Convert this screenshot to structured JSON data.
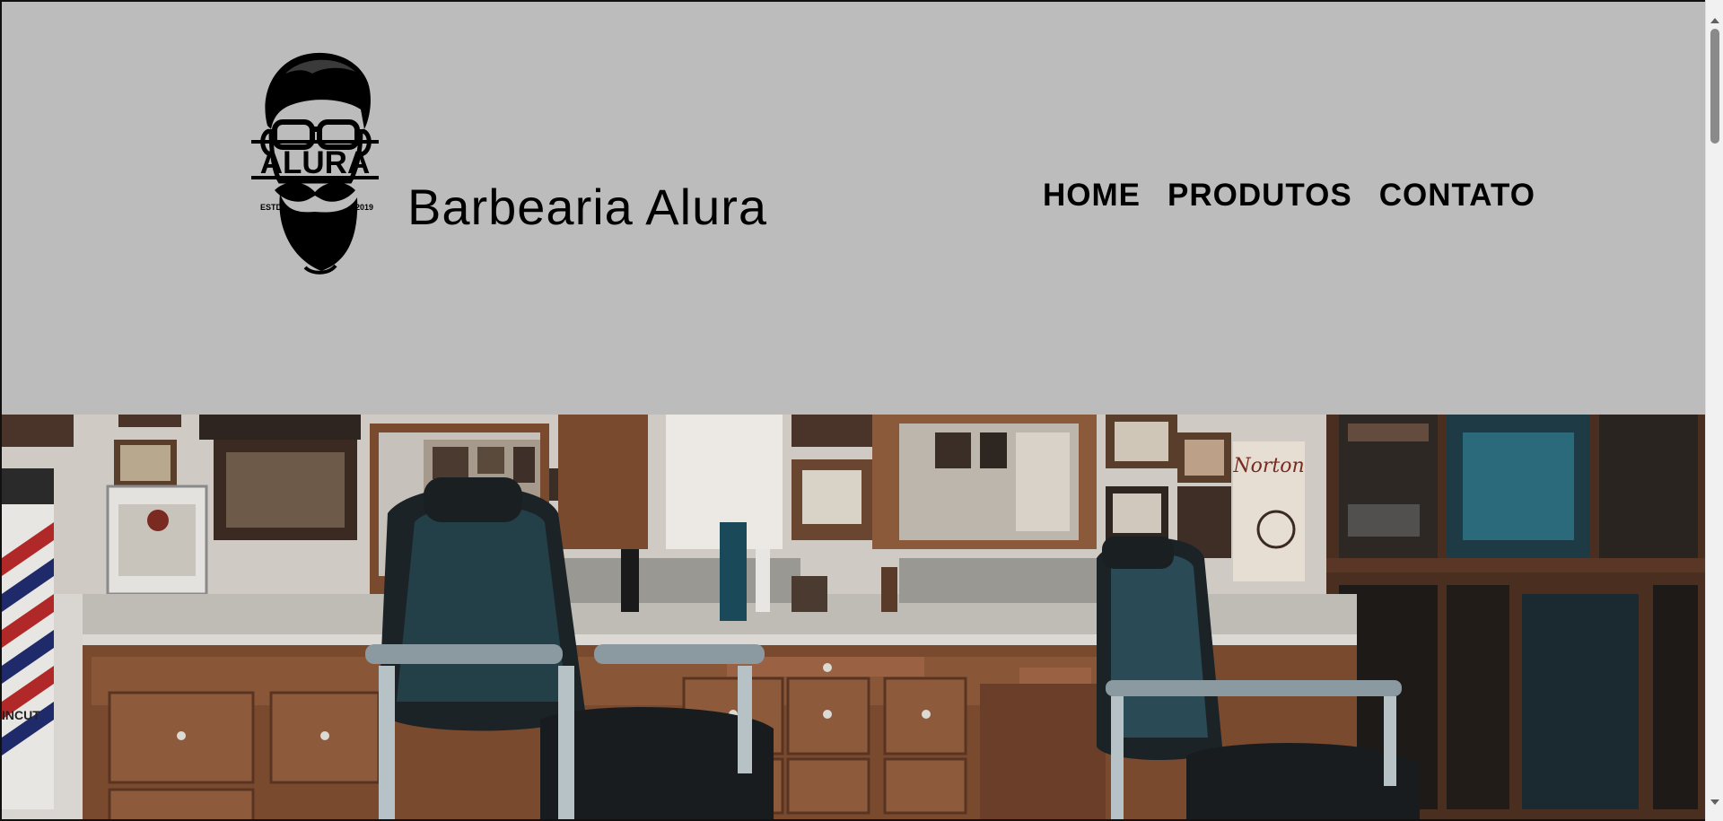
{
  "header": {
    "site_title": "Barbearia Alura"
  },
  "logo": {
    "wordmark": "ALURA",
    "left_text": "ESTD",
    "right_text": "2019",
    "icon": "bearded-man-logo"
  },
  "nav": {
    "items": [
      {
        "label": "HOME"
      },
      {
        "label": "PRODUTOS"
      },
      {
        "label": "CONTATO"
      }
    ]
  },
  "hero": {
    "image": "barbershop-interior-photo",
    "sign_text": "Norton",
    "pole_text": "INCUT"
  },
  "colors": {
    "header_bg": "#bcbcbc",
    "text": "#000000",
    "wood": "#7a4a2f",
    "chair": "#1e2a30"
  }
}
